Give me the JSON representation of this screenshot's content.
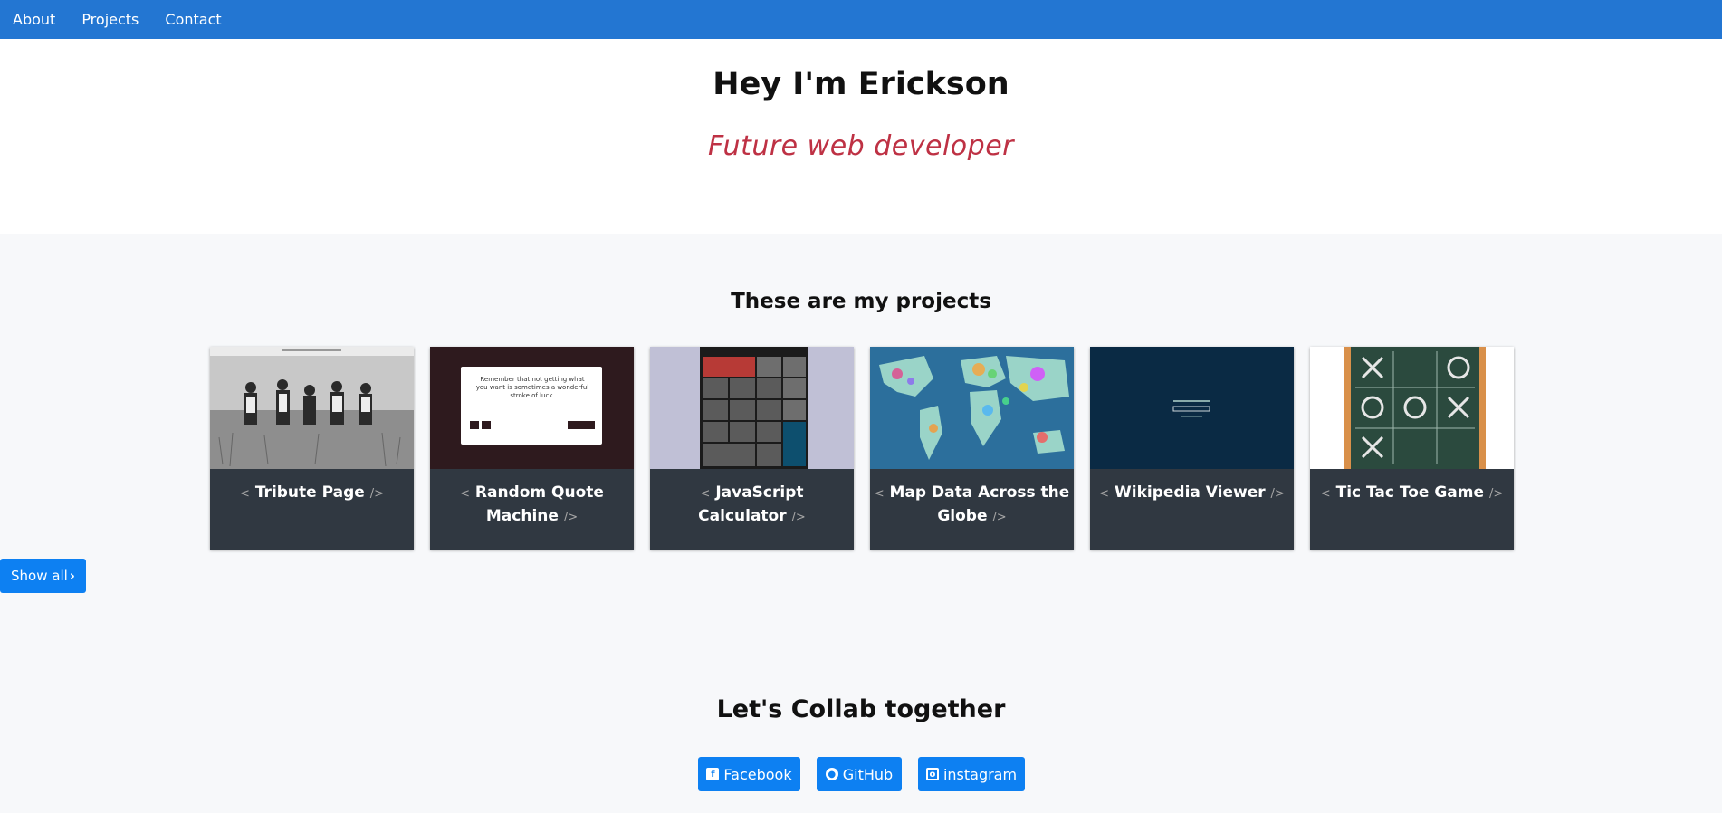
{
  "nav": {
    "items": [
      "About",
      "Projects",
      "Contact"
    ]
  },
  "hero": {
    "title": "Hey I'm Erickson",
    "subtitle": "Future web developer"
  },
  "projects": {
    "title": "These are my projects",
    "open_bracket": "<",
    "close_bracket": "/>",
    "cards": [
      {
        "name": "Tribute Page"
      },
      {
        "name": "Random Quote Machine"
      },
      {
        "name": "JavaScript Calculator"
      },
      {
        "name": "Map Data Across the Globe"
      },
      {
        "name": "Wikipedia Viewer"
      },
      {
        "name": "Tic Tac Toe Game"
      }
    ],
    "show_all_label": "Show all",
    "quote_text": "Remember that not getting what you want is sometimes a wonderful stroke of luck."
  },
  "collab": {
    "title": "Let's Collab together",
    "links": [
      {
        "label": "Facebook",
        "icon": "facebook-icon"
      },
      {
        "label": "GitHub",
        "icon": "github-icon"
      },
      {
        "label": "instagram",
        "icon": "instagram-icon"
      }
    ]
  },
  "colors": {
    "nav": "#2376d2",
    "accent": "#be3144",
    "button": "#0d80f2",
    "card": "#303841"
  }
}
